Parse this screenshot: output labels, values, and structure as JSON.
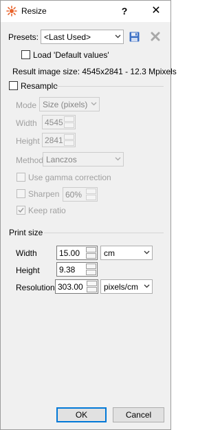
{
  "window": {
    "title": "Resize"
  },
  "titlebar": {
    "help_label": "?",
    "close_label": "✕"
  },
  "presets": {
    "label": "Presets:",
    "selected": "<Last Used>",
    "load_default_label": "Load 'Default values'",
    "load_default_checked": false
  },
  "result": {
    "text": "Result image size: 4545x2841 - 12.3 Mpixels"
  },
  "resample": {
    "label": "Resample",
    "checked": false,
    "mode_label": "Mode",
    "mode_value": "Size (pixels)",
    "width_label": "Width",
    "width_value": "4545",
    "height_label": "Height",
    "height_value": "2841",
    "method_label": "Method",
    "method_value": "Lanczos",
    "gamma_label": "Use gamma correction",
    "sharpen_label": "Sharpen",
    "sharpen_value": "60%",
    "keep_ratio_label": "Keep ratio",
    "keep_ratio_checked": true
  },
  "print_size": {
    "title": "Print size",
    "width_label": "Width",
    "width_value": "15.00",
    "width_unit": "cm",
    "height_label": "Height",
    "height_value": "9.38",
    "resolution_label": "Resolution",
    "resolution_value": "303.00",
    "resolution_unit": "pixels/cm"
  },
  "footer": {
    "ok_label": "OK",
    "cancel_label": "Cancel"
  },
  "colors": {
    "accent": "#0078d7",
    "save_icon": "#3b6fc4",
    "app_icon": "#e8622a"
  }
}
